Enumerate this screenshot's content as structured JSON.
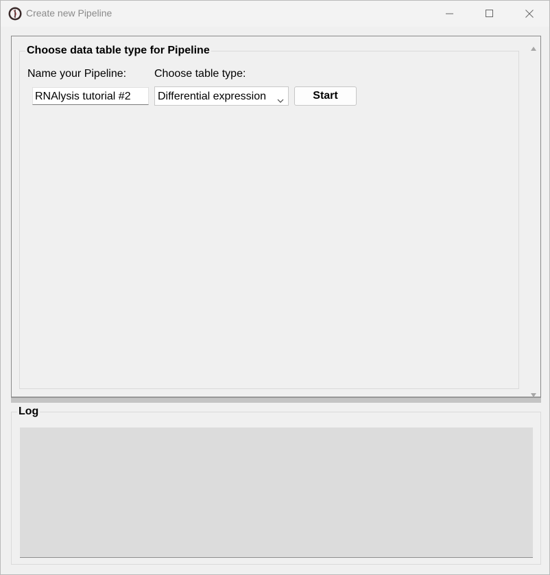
{
  "window": {
    "title": "Create new Pipeline",
    "icons": {
      "app": "rnalysis-logo-icon",
      "minimize": "minimize-icon",
      "maximize": "maximize-icon",
      "close": "close-icon"
    }
  },
  "main_group": {
    "title": "Choose data table type for Pipeline",
    "name_label": "Name your Pipeline:",
    "name_value": "RNAlysis tutorial #2",
    "type_label": "Choose table type:",
    "type_selected": "Differential expression",
    "start_label": "Start"
  },
  "log_group": {
    "title": "Log",
    "content": ""
  },
  "colors": {
    "background": "#f0f0f0",
    "log_background": "#dcdcdc",
    "title_text": "#8a8a8a"
  }
}
